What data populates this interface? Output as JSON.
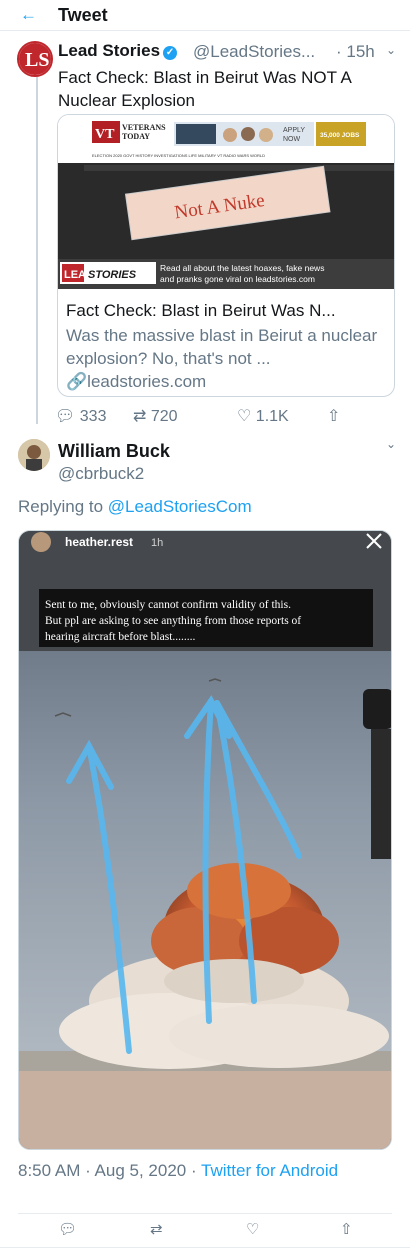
{
  "header": {
    "back_icon": "left-arrow-icon",
    "title": "Tweet"
  },
  "tweet1": {
    "name": "Lead Stories",
    "verified_icon": "verified-badge-icon",
    "handle": "@LeadStories...",
    "time": "· 15h",
    "text": "Fact Check: Blast in Beirut Was NOT A Nuclear Explosion",
    "card": {
      "image": {
        "logo": "VT",
        "logo_words": "VETERANS TODAY",
        "nav": "ELECTION 2020   GOVT   HISTORY   INVESTIGATIONS   LIFE   MILITARY   VT RADIO   WARS   WORLD",
        "ad_text": "APPLY NOW",
        "ad_jobs": "35,000 JOBS",
        "stamp": "Not A Nuke",
        "banner_logo": "LEAD STORIES",
        "banner_text": "Read all about the latest hoaxes, fake news and pranks gone viral on leadstories.com"
      },
      "title": "Fact Check: Blast in Beirut Was N...",
      "description": "Was the massive blast in Beirut a nuclear explosion? No, that's not ...",
      "link_icon": "link-icon",
      "link": "leadstories.com"
    },
    "actions": {
      "replies": "333",
      "retweets": "720",
      "likes": "1.1K"
    }
  },
  "tweet2": {
    "name": "William Buck",
    "handle": "@cbrbuck2",
    "replying_prefix": "Replying to ",
    "replying_to": "@LeadStoriesCom",
    "photo": {
      "story_user": "heather.rest",
      "story_time": "1h",
      "caption": "Sent to me, obviously cannot confirm validity of this. But ppl are asking to see anything from those reports of hearing aircraft before blast........"
    },
    "timestamp": "8:50 AM · Aug 5, 2020 · ",
    "client": "Twitter for Android"
  },
  "colors": {
    "accent": "#1da1f2",
    "muted": "#657786",
    "border": "#ccd6dd"
  }
}
